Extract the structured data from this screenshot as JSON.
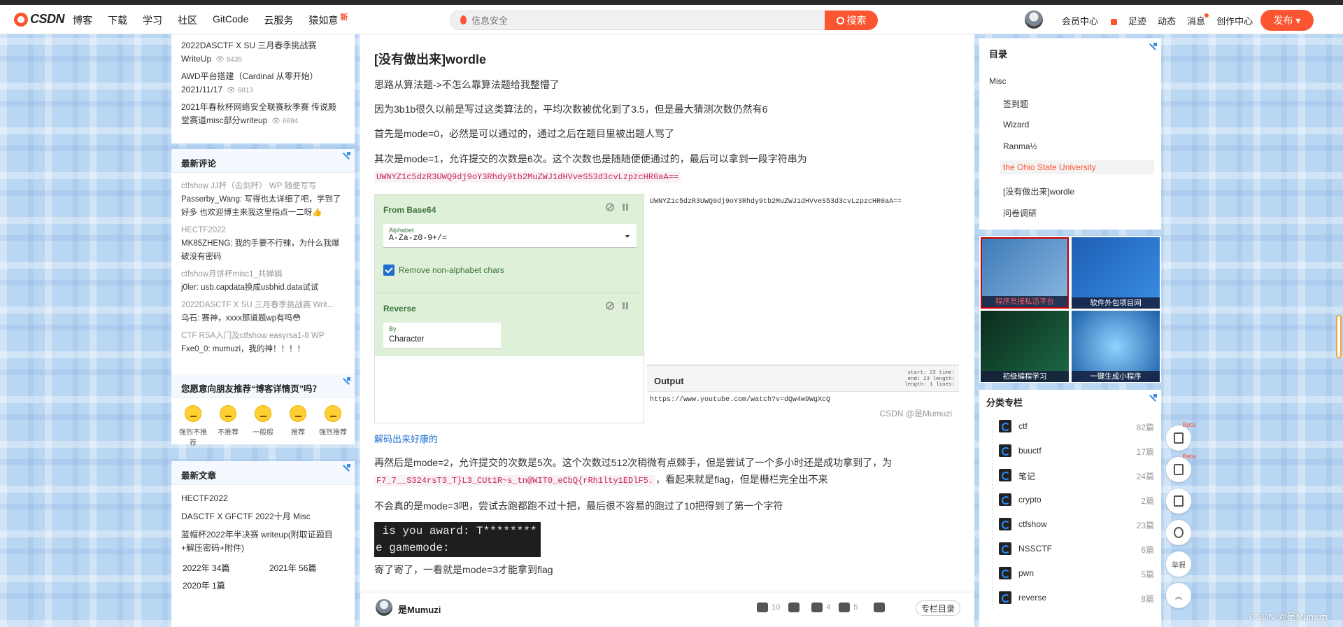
{
  "nav": {
    "logo": "CSDN",
    "items": [
      "博客",
      "下载",
      "学习",
      "社区",
      "GitCode",
      "云服务",
      "猿如意"
    ],
    "new_badge": "新",
    "search_placeholder": "信息安全",
    "search_button": "搜索",
    "right": [
      "会员中心",
      "足迹",
      "动态",
      "消息",
      "创作中心"
    ],
    "publish": "发布"
  },
  "left": {
    "popular": [
      {
        "title": "2022DASCTF X SU 三月春季挑战赛 WriteUp",
        "views": "8435"
      },
      {
        "title": "AWD平台搭建（Cardinal 从零开始） 2021/11/17",
        "views": "6813"
      },
      {
        "title": "2021年春秋杯网络安全联赛秋季赛 传说殿堂赛道misc部分writeup",
        "views": "6694"
      }
    ],
    "comments_title": "最新评论",
    "comments": [
      {
        "topic": "ctfshow JJ杯（击剑杯） WP 随便写写",
        "text": "Passerby_Wang: 写得也太详细了吧，学到了好多 也欢迎博主来我这里指点一二呀👍"
      },
      {
        "topic": "HECTF2022",
        "text": "MK85ZHENG: 我的手要不行辣，为什么我爆破没有密码"
      },
      {
        "topic": "ctfshow月饼杯misc1_共婵娟",
        "text": "j0ler: usb.capdata换成usbhid.data试试"
      },
      {
        "topic": "2022DASCTF X SU 三月春季挑战赛 Writ...",
        "text": "乌石: 赛神，xxxx那道题wp有吗😳"
      },
      {
        "topic": "CTF RSA入门及ctfshow easyrsa1-8 WP",
        "text": "Fxe0_0: mumuzi，我的神！！！！"
      }
    ],
    "recommend_title": "您愿意向朋友推荐“博客详情页”吗？",
    "faces": [
      "强烈不推荐",
      "不推荐",
      "一般般",
      "推荐",
      "强烈推荐"
    ],
    "articles_title": "最新文章",
    "articles": [
      "HECTF2022",
      "DASCTF X GFCTF 2022十月 Misc",
      "蓝帽杯2022年半决赛 writeup(附取证题目+解压密码+附件)"
    ],
    "archive": [
      "2022年 34篇",
      "2021年 56篇",
      "2020年 1篇"
    ]
  },
  "article": {
    "heading": "[没有做出来]wordle",
    "p1": "思路从算法题->不怎么靠算法题给我整懵了",
    "p2": "因为3b1b很久以前是写过这类算法的，平均次数被优化到了3.5，但是最大猜测次数仍然有6",
    "p3": "首先是mode=0，必然是可以通过的，通过之后在题目里被出题人骂了",
    "p4": "其次是mode=1，允许提交的次数是6次。这个次数也是随随便便通过的，最后可以拿到一段字符串为",
    "code1": "UWNYZ1c5dzR3UWQ9dj9oY3Rhdy9tb2MuZWJ1dHVveS53d3cvLzpzcHR0aA==",
    "cyberchef": {
      "op1_name": "From Base64",
      "alphabet_label": "Alphabet",
      "alphabet_value": "A-Za-z0-9+/=",
      "checkbox_label": "Remove non-alphabet chars",
      "op2_name": "Reverse",
      "by_label": "By",
      "by_value": "Character",
      "input": "UWNYZ1c5dzR3UWQ9dj9oY3Rhdy9tb2MuZWJ1dHVveS53d3cvLzpzcHR0aA==",
      "output_title": "Output",
      "stats": [
        "start: 22    time:",
        "end: 23  length:",
        "length: 1    lines:"
      ],
      "output": "https://www.youtube.com/watch?v=dQw4w9WgXcQ",
      "watermark": "CSDN @是Mumuzi"
    },
    "link": "解码出来好康的",
    "p5a": "再然后是mode=2，允许提交的次数是5次。这个次数过512次稍微有点棘手，但是尝试了一个多小时还是成功拿到了，为",
    "code2": "F7_7__S324rsT3_T}L3_CUt1R~s_tn@WIT0_eCbQ{rRh1lty1EDlF5.",
    "p5b": "，看起来就是flag，但是栅栏完全出不来",
    "p6": "不会真的是mode=3吧，尝试去跑都跑不过十把，最后很不容易的跑过了10把得到了第一个字符",
    "terminal": " is you award: T********\ne gamemode:",
    "p7": "寄了寄了，一看就是mode=3才能拿到flag"
  },
  "bottom": {
    "author": "是Mumuzi",
    "likes": "10",
    "stars": "4",
    "comments": "5",
    "catalog_button": "专栏目录"
  },
  "right": {
    "toc_title": "目录",
    "toc": [
      "Misc",
      "签到题",
      "Wizard",
      "Ranma½",
      "the Ohio State University",
      "[没有做出来]wordle",
      "问卷调研"
    ],
    "ads": [
      "程序员接私活平台",
      "软件外包项目网",
      "初级编程学习",
      "一键生成小程序"
    ],
    "cats_title": "分类专栏",
    "cats": [
      {
        "name": "ctf",
        "count": "82篇"
      },
      {
        "name": "buuctf",
        "count": "17篇"
      },
      {
        "name": "笔记",
        "count": "24篇"
      },
      {
        "name": "crypto",
        "count": "2篇"
      },
      {
        "name": "ctfshow",
        "count": "23篇"
      },
      {
        "name": "NSSCTF",
        "count": "6篇"
      },
      {
        "name": "pwn",
        "count": "5篇"
      },
      {
        "name": "reverse",
        "count": "8篇"
      }
    ]
  },
  "tools": {
    "beta": "Beta",
    "report": "举报"
  },
  "footer_watermark": "CSDN @是Mumuzi",
  "colors": {
    "accent": "#fc5531",
    "link": "#1e6fd0",
    "cyberchef_op": "#dff0d8"
  }
}
